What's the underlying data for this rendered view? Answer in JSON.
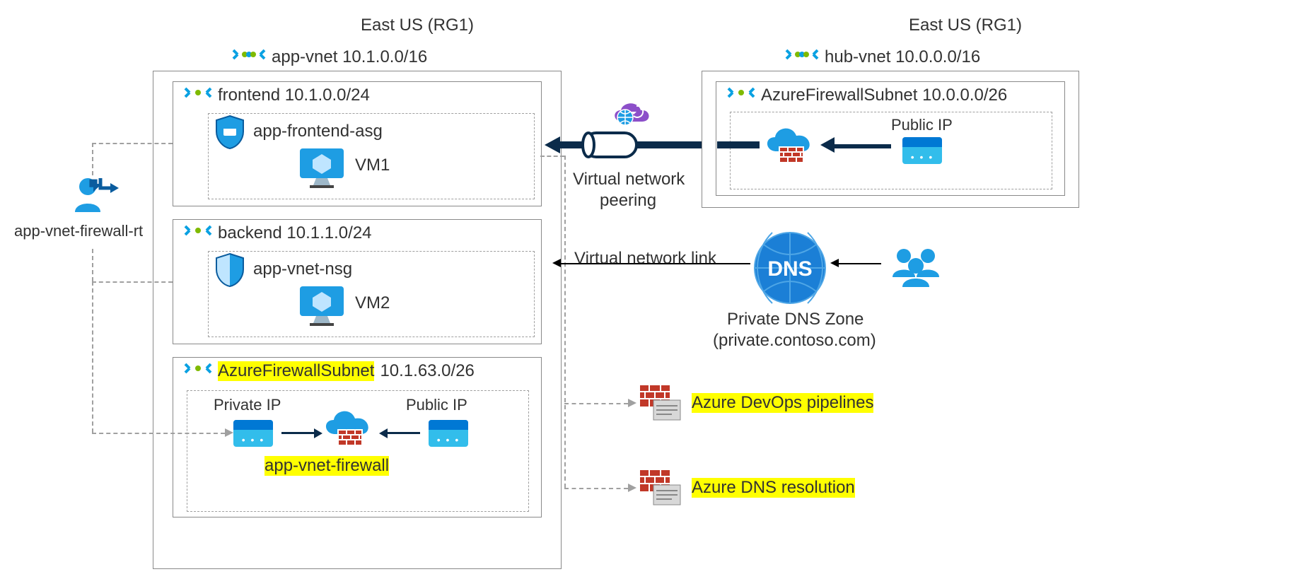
{
  "left_region": {
    "title": "East US (RG1)",
    "vnet": {
      "label": "app-vnet 10.1.0.0/16",
      "subnets": {
        "frontend": {
          "title": "frontend 10.1.0.0/24",
          "asg": "app-frontend-asg",
          "vm": "VM1"
        },
        "backend": {
          "title": "backend 10.1.1.0/24",
          "nsg": "app-vnet-nsg",
          "vm": "VM2"
        },
        "firewall": {
          "name": "AzureFirewallSubnet",
          "cidr": "10.1.63.0/26",
          "private_ip": "Private IP",
          "public_ip": "Public IP",
          "fw_name": "app-vnet-firewall"
        }
      }
    }
  },
  "route_table": {
    "label": "app-vnet-firewall-rt"
  },
  "peering": {
    "label1": "Virtual network",
    "label2": "peering"
  },
  "right_region": {
    "title": "East US (RG1)",
    "vnet": {
      "label": "hub-vnet 10.0.0.0/16",
      "subnet": {
        "title": "AzureFirewallSubnet 10.0.0.0/26",
        "public_ip": "Public IP"
      }
    }
  },
  "dns_link": {
    "label": "Virtual network link",
    "title": "Private DNS Zone",
    "domain": "(private.contoso.com)"
  },
  "firewall_targets": {
    "devops": "Azure DevOps pipelines",
    "dns": "Azure DNS resolution"
  }
}
